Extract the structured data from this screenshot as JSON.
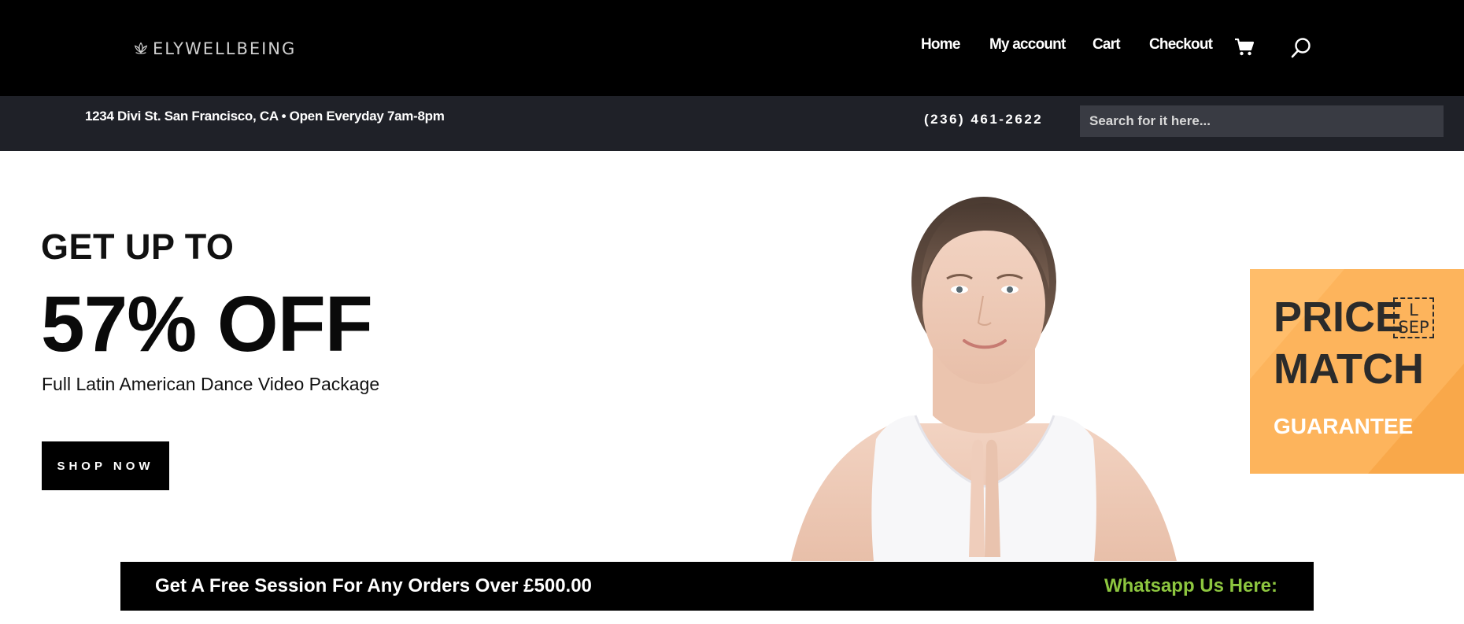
{
  "header": {
    "logo_text": "ELYWELLBEING",
    "nav": [
      {
        "label": "Home"
      },
      {
        "label": "My account"
      },
      {
        "label": "Cart"
      },
      {
        "label": "Checkout"
      }
    ],
    "cart_icon": "shopping-cart-icon",
    "search_icon": "search-icon"
  },
  "subbar": {
    "address": "1234 Divi St. San Francisco, CA • Open Everyday 7am-8pm",
    "phone": "(236) 461-2622",
    "search_placeholder": "Search for it here..."
  },
  "hero": {
    "kicker": "GET UP TO",
    "headline": "57% OFF",
    "subheadline": "Full Latin American Dance Video Package",
    "cta_label": "SHOP NOW"
  },
  "badge": {
    "line1": "PRICE",
    "line2": "MATCH",
    "line3": "GUARANTEE",
    "glyph_top": "L",
    "glyph_bottom": "SEP"
  },
  "promo": {
    "text": "Get A Free Session For Any Orders Over £500.00",
    "whatsapp": "Whatsapp Us Here:"
  },
  "colors": {
    "header_bg": "#000000",
    "subbar_bg": "#1f2128",
    "search_bg": "#393b43",
    "badge_orange": "#fdb45c",
    "whatsapp_green": "#8dc63f"
  }
}
